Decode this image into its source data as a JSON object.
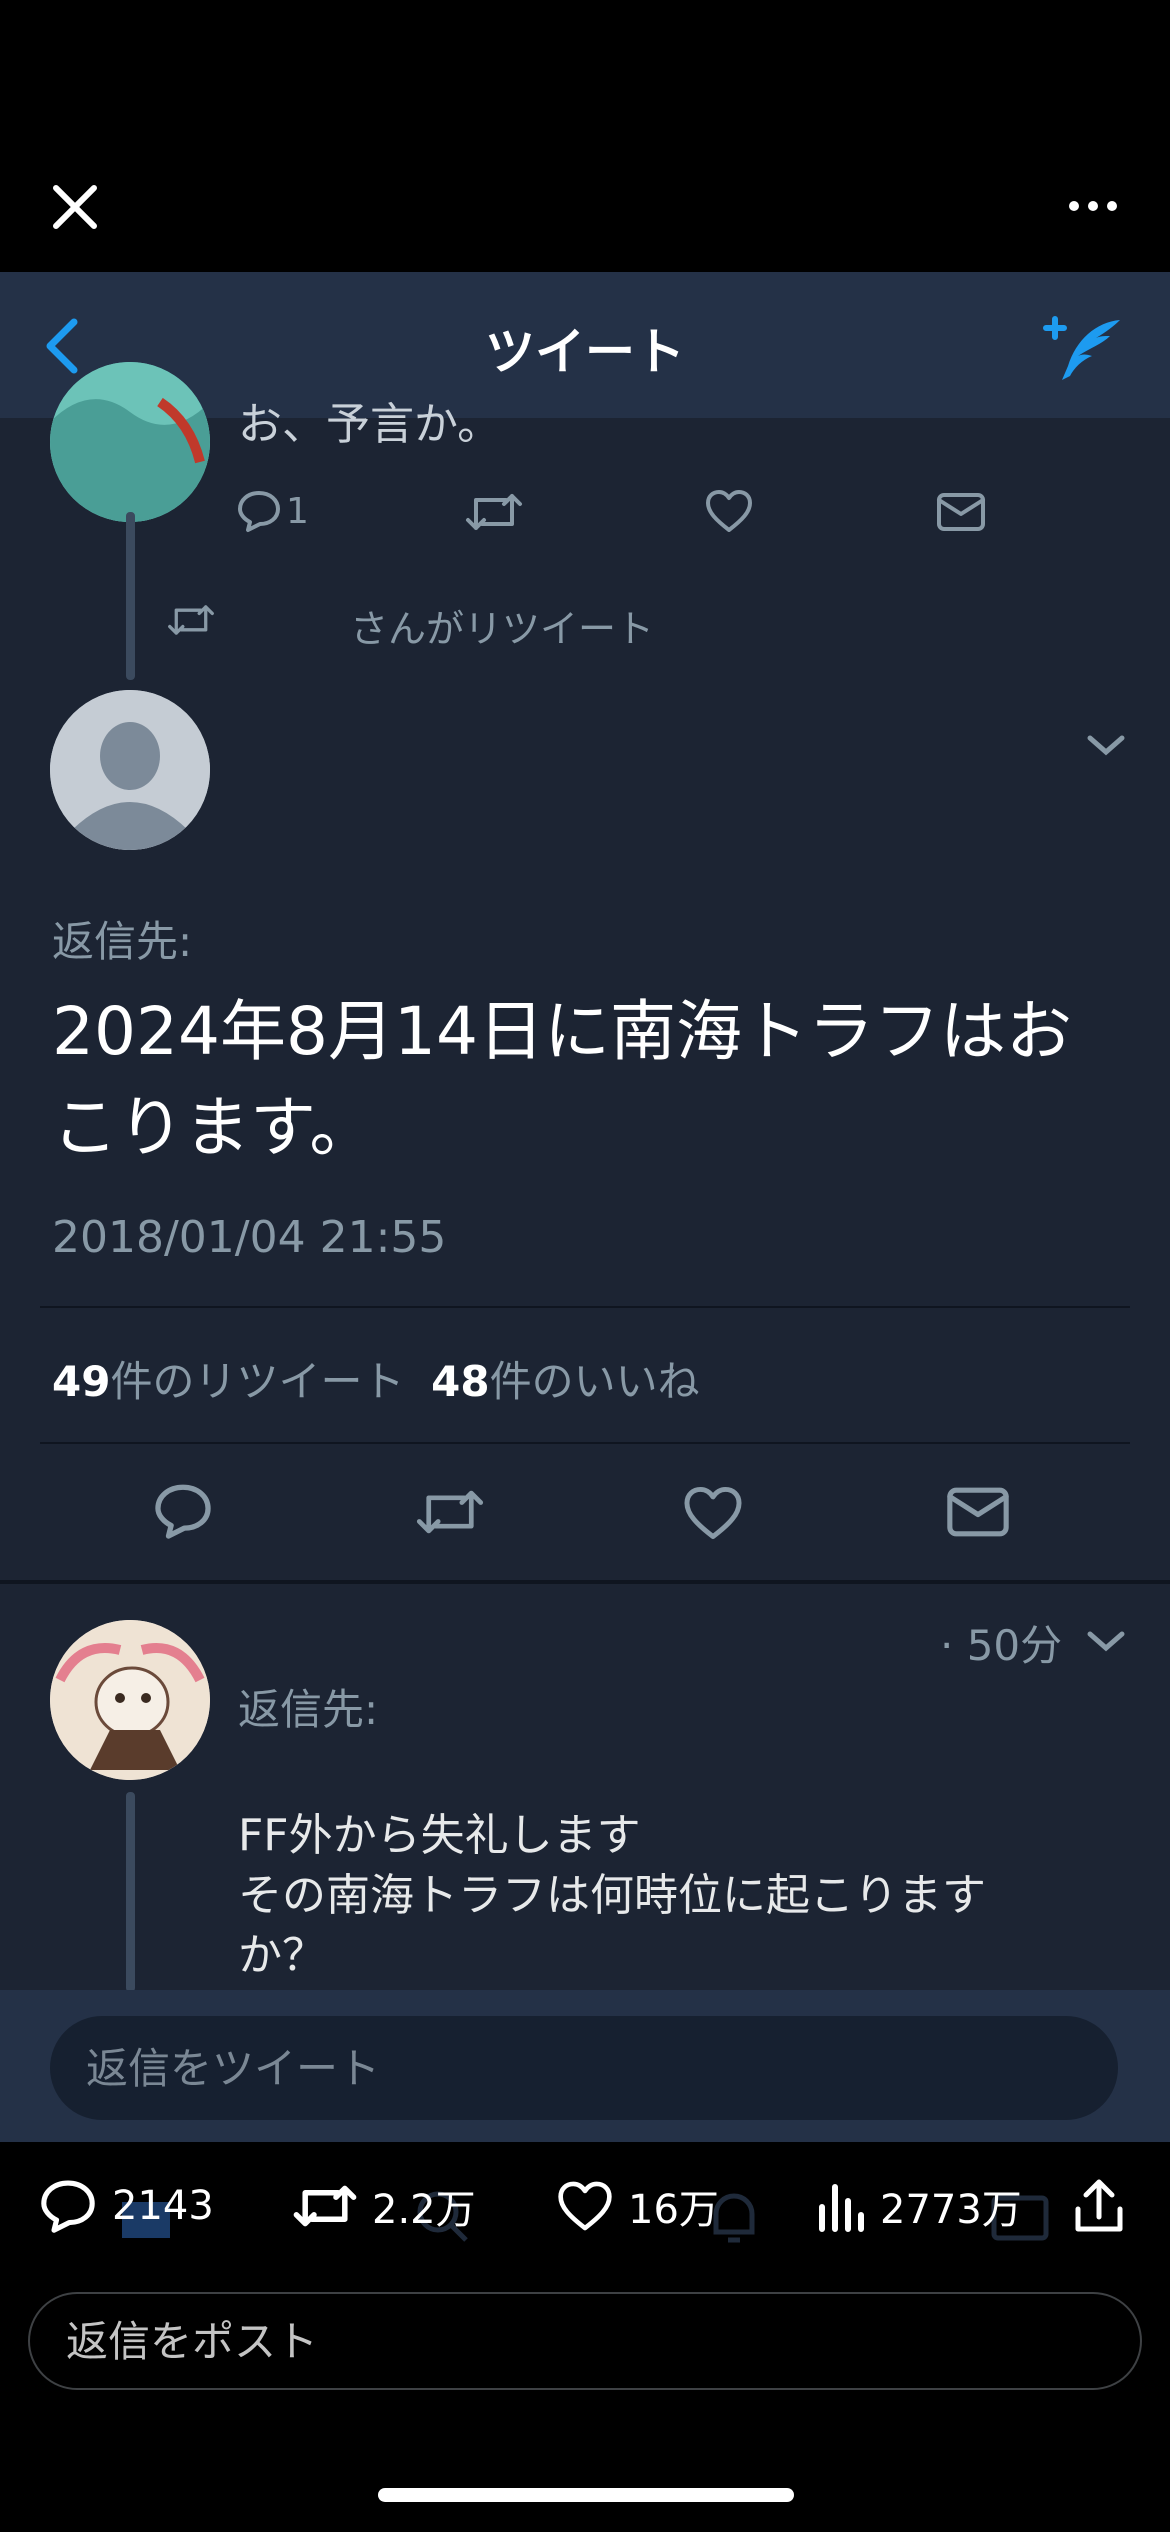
{
  "viewer": {
    "close_icon": "close-icon",
    "more_icon": "more-horizontal-icon"
  },
  "screenshot": {
    "header": {
      "title": "ツイート",
      "back_icon": "back-chevron-icon",
      "compose_icon": "compose-tweet-icon"
    },
    "prev_tweet": {
      "partial_text": "お、予言か。",
      "reply_count": "1"
    },
    "retweet_banner": "さんがリツイート",
    "main_tweet": {
      "reply_to": "返信先:",
      "text": "2024年8月14日に南海トラフはおこります。",
      "date": "2018/01/04 21:55",
      "retweet_count": "49",
      "retweet_label": "件のリツイート",
      "like_count": "48",
      "like_label": "件のいいね"
    },
    "reply": {
      "time": "· 50分",
      "reply_to": "返信先:",
      "lines": [
        "FF外から失礼します",
        "その南海トラフは何時位に起こります",
        "か？"
      ]
    },
    "reply_input_placeholder": "返信をツイート"
  },
  "post_actions": {
    "replies": "2143",
    "reposts": "2.2万",
    "likes": "16万",
    "views": "2773万"
  },
  "reply_placeholder": "返信をポスト",
  "colors": {
    "twitter_blue": "#1d9bf0",
    "screenshot_bg": "#1c2433",
    "screenshot_header": "#243147",
    "muted_text": "#8899a6"
  }
}
